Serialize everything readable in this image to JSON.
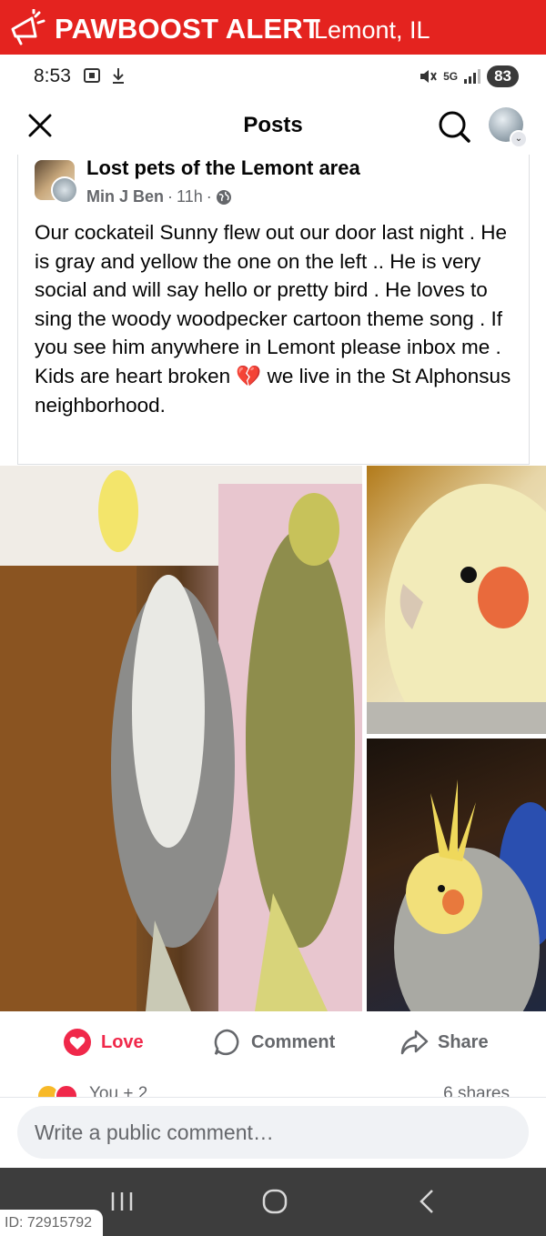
{
  "banner": {
    "brand": "PAWBOOST ALERT",
    "location": "Lemont, IL",
    "icon": "megaphone-icon",
    "color": "#e4231f"
  },
  "status_bar": {
    "time": "8:53",
    "network": "5G",
    "battery": "83"
  },
  "top_nav": {
    "title": "Posts",
    "close_icon": "close-icon",
    "search_icon": "search-icon"
  },
  "post": {
    "group_name": "Lost pets of the Lemont area",
    "author": "Min J Ben",
    "time_ago": "11h",
    "separator": "·",
    "privacy_icon": "globe-icon",
    "text": "Our cockateil Sunny flew out our door last night . He is  gray and yellow the one on the left .. He is very social and will say hello or pretty bird . He loves to sing the woody woodpecker cartoon theme song . If you see him anywhere in Lemont please inbox me . Kids are heart broken 💔 we live in the St Alphonsus neighborhood.",
    "photos": [
      "cockatiel-pair-photo",
      "cockatiel-closeup-photo",
      "cockatiel-crest-photo"
    ]
  },
  "actions": {
    "love": "Love",
    "comment": "Comment",
    "share": "Share"
  },
  "reactions": {
    "text": "You + 2",
    "shares": "6 shares"
  },
  "comment_box": {
    "placeholder": "Write a public comment…"
  },
  "watermark": {
    "id": "ID: 72915792"
  }
}
